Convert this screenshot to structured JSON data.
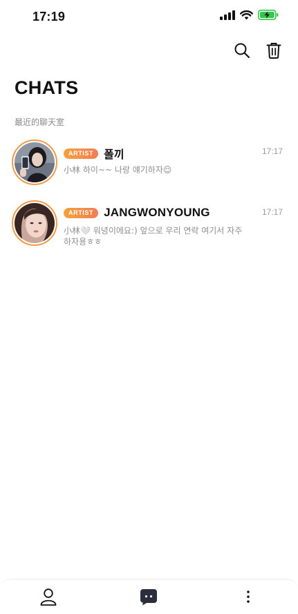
{
  "status_bar": {
    "time": "17:19",
    "icons": [
      "signal-icon",
      "wifi-icon",
      "battery-charging-icon"
    ],
    "battery_color": "#33c649"
  },
  "header": {
    "title": "CHATS",
    "actions": [
      "search-icon",
      "trash-icon"
    ]
  },
  "section_label": "最近的聊天室",
  "accent_color": "#f59b45",
  "chats": [
    {
      "badge": "ARTIST",
      "name": "폴끼",
      "time": "17:17",
      "preview": "小林 하이~~ 나랑 얘기하자😌"
    },
    {
      "badge": "ARTIST",
      "name": "JANGWONYOUNG",
      "time": "17:17",
      "preview": "小林🤍 워녕이에요:) 앞으로 우리 연락 여기서 자주하자용ㅎㅎ"
    }
  ],
  "bottom_nav": {
    "items": [
      "person-icon",
      "chat-bubble-icon",
      "more-icon"
    ]
  }
}
